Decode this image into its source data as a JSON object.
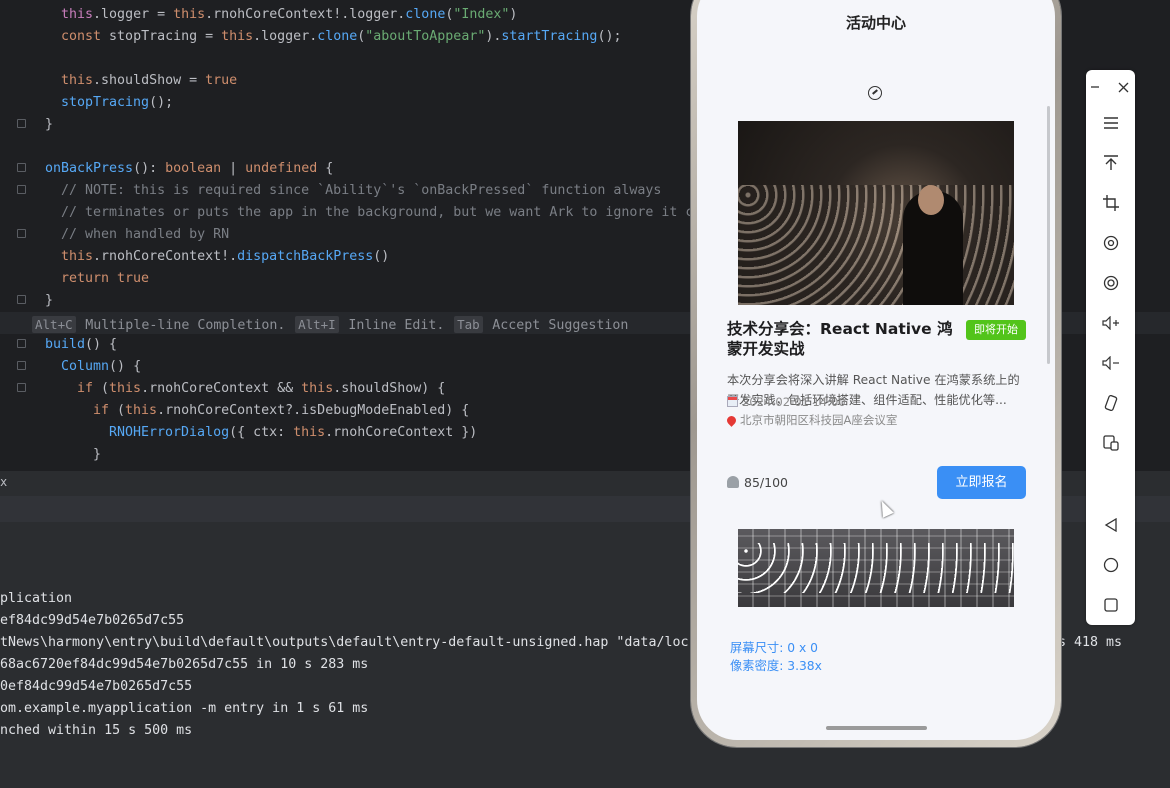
{
  "editor": {
    "lines": [
      {
        "segments": [
          [
            "prop",
            "this"
          ],
          [
            "plain",
            "."
          ],
          [
            "plain",
            "logger = "
          ],
          [
            "kw",
            "this"
          ],
          [
            "plain",
            "."
          ],
          [
            "plain",
            "rnohCoreContext!.logger."
          ],
          [
            "fn",
            "clone"
          ],
          [
            "plain",
            "("
          ],
          [
            "str",
            "\"Index\""
          ],
          [
            "plain",
            ")"
          ]
        ]
      },
      {
        "segments": [
          [
            "kw",
            "const "
          ],
          [
            "plain",
            "stopTracing = "
          ],
          [
            "kw",
            "this"
          ],
          [
            "plain",
            ".logger."
          ],
          [
            "fn",
            "clone"
          ],
          [
            "plain",
            "("
          ],
          [
            "str",
            "\"aboutToAppear\""
          ],
          [
            "plain",
            ")."
          ],
          [
            "fn",
            "startTracing"
          ],
          [
            "plain",
            "();"
          ]
        ]
      },
      {
        "segments": []
      },
      {
        "segments": [
          [
            "kw",
            "this"
          ],
          [
            "plain",
            ".shouldShow = "
          ],
          [
            "kw",
            "true"
          ]
        ]
      },
      {
        "segments": [
          [
            "fn",
            "stopTracing"
          ],
          [
            "plain",
            "();"
          ]
        ]
      },
      {
        "segments": [
          [
            "plain",
            "}"
          ]
        ]
      },
      {
        "segments": []
      },
      {
        "segments": [
          [
            "fn",
            "onBackPress"
          ],
          [
            "plain",
            "(): "
          ],
          [
            "kw",
            "boolean"
          ],
          [
            "plain",
            " | "
          ],
          [
            "kw",
            "undefined"
          ],
          [
            "plain",
            " {"
          ]
        ]
      },
      {
        "segments": [
          [
            "cm",
            "// NOTE: this is required since `Ability`'s `onBackPressed` function always"
          ]
        ]
      },
      {
        "segments": [
          [
            "cm",
            "// terminates or puts the app in the background, but we want Ark to ignore it c"
          ]
        ]
      },
      {
        "segments": [
          [
            "cm",
            "// when handled by RN"
          ]
        ]
      },
      {
        "segments": [
          [
            "kw",
            "this"
          ],
          [
            "plain",
            ".rnohCoreContext!."
          ],
          [
            "fn",
            "dispatchBackPress"
          ],
          [
            "plain",
            "()"
          ]
        ]
      },
      {
        "segments": [
          [
            "kw",
            "return true"
          ]
        ]
      },
      {
        "segments": [
          [
            "plain",
            "}"
          ]
        ]
      }
    ],
    "hint": {
      "k1": "Alt+C",
      "t1": "Multiple-line Completion.",
      "k2": "Alt+I",
      "t2": "Inline Edit.",
      "k3": "Tab",
      "t3": "Accept Suggestion"
    },
    "lines2": [
      {
        "segments": [
          [
            "fn",
            "build"
          ],
          [
            "plain",
            "() {"
          ]
        ]
      },
      {
        "segments": [
          [
            "fn",
            "Column"
          ],
          [
            "plain",
            "() {"
          ]
        ]
      },
      {
        "segments": [
          [
            "kw",
            "if"
          ],
          [
            "plain",
            " ("
          ],
          [
            "kw",
            "this"
          ],
          [
            "plain",
            ".rnohCoreContext && "
          ],
          [
            "kw",
            "this"
          ],
          [
            "plain",
            ".shouldShow) {"
          ]
        ]
      },
      {
        "segments": [
          [
            "kw",
            "if"
          ],
          [
            "plain",
            " ("
          ],
          [
            "kw",
            "this"
          ],
          [
            "plain",
            ".rnohCoreContext?."
          ],
          [
            "plain",
            "isDebugModeEnabled) {"
          ]
        ]
      },
      {
        "segments": [
          [
            "fn",
            "RNOHErrorDialog"
          ],
          [
            "plain",
            "({ ctx: "
          ],
          [
            "kw",
            "this"
          ],
          [
            "plain",
            ".rnohCoreContext })"
          ]
        ]
      },
      {
        "segments": [
          [
            "plain",
            "}"
          ]
        ]
      }
    ]
  },
  "divider_label": "x",
  "console": {
    "lines": [
      "plication",
      "ef84dc99d54e7b0265d7c55",
      "tNews\\harmony\\entry\\build\\default\\outputs\\default\\entry-default-unsigned.hap \"data/loc",
      "68ac6720ef84dc99d54e7b0265d7c55 in 10 s 283 ms",
      "0ef84dc99d54e7b0265d7c55",
      "om.example.myapplication -m entry in 1 s 61 ms",
      "nched within 15 s 500 ms"
    ],
    "right_suffix": "s 418 ms"
  },
  "app": {
    "title": "活动中心",
    "card": {
      "title": "技术分享会：React Native 鸿蒙开发实战",
      "badge": "即将开始",
      "badge_color": "#52c41a",
      "description": "本次分享会将深入讲解 React Native 在鸿蒙系统上的开发实践，包括环境搭建、组件适配、性能优化等...",
      "date": "2024-02-01 14:00",
      "location": "北京市朝阳区科技园A座会议室",
      "count": "85/100",
      "signup_label": "立即报名",
      "accent": "#3a8ff5"
    },
    "debug": {
      "screen_size": "屏幕尺寸: 0 x 0",
      "pixel_density": "像素密度: 3.38x"
    }
  },
  "toolbar": {
    "items": [
      "minimize-icon",
      "close-icon",
      "menu-icon",
      "pin-top-icon",
      "crop-icon",
      "rotate-icon",
      "screenshot-icon",
      "volume-up-icon",
      "volume-down-icon",
      "shake-icon",
      "multi-screen-icon",
      "back-icon",
      "home-icon",
      "recents-icon"
    ]
  }
}
